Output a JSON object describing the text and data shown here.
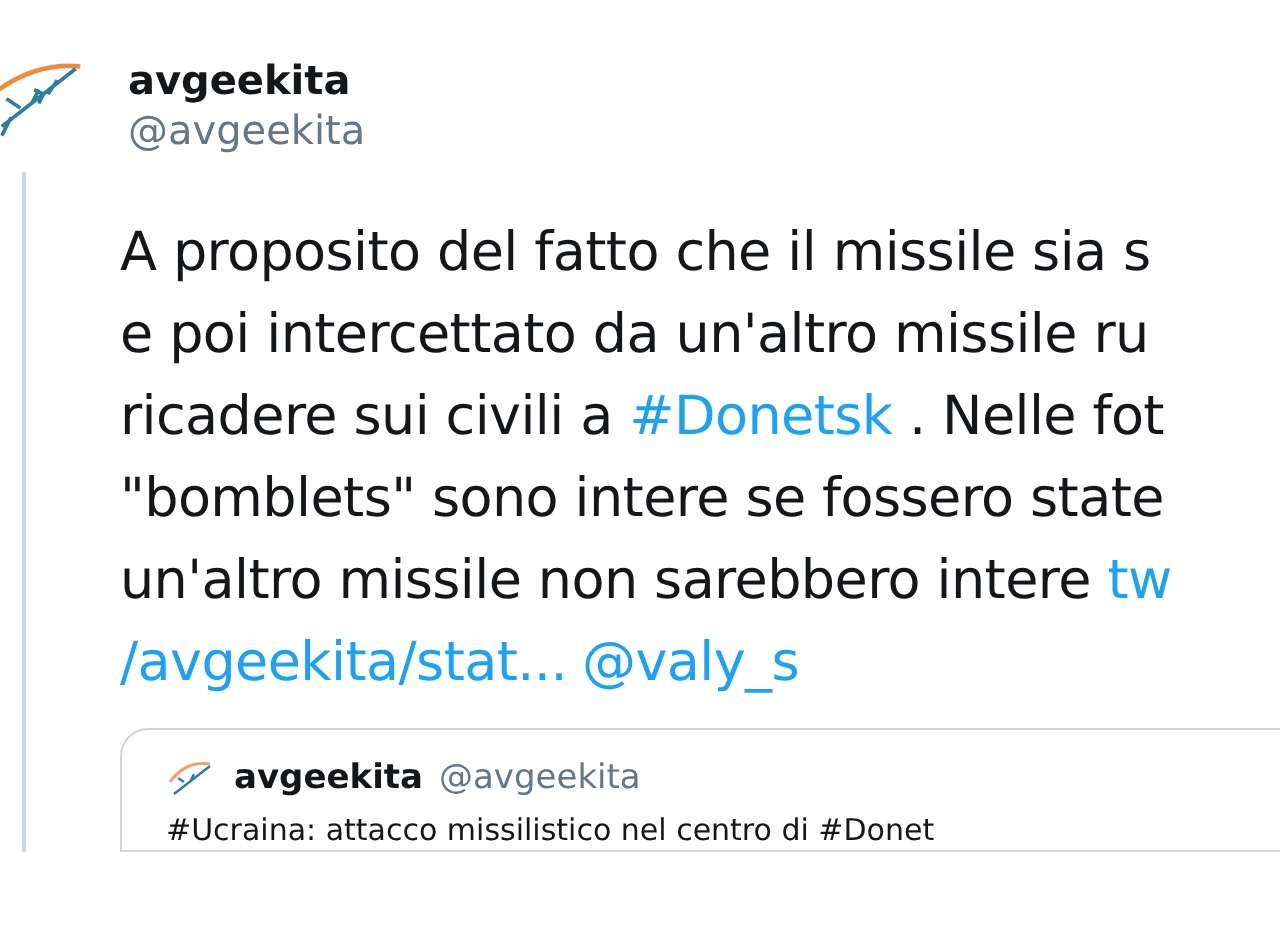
{
  "author": {
    "name": "avgeekita",
    "handle": "@avgeekita"
  },
  "body_lines": [
    [
      {
        "kind": "plain",
        "text": "A proposito del fatto che il missile sia s"
      }
    ],
    [
      {
        "kind": "plain",
        "text": "e poi intercettato da un'altro missile ru"
      }
    ],
    [
      {
        "kind": "plain",
        "text": "ricadere sui civili a "
      },
      {
        "kind": "hashtag",
        "text": "#Donetsk"
      },
      {
        "kind": "plain",
        "text": " . Nelle fot"
      }
    ],
    [
      {
        "kind": "plain",
        "text": "\"bomblets\" sono intere se fossero state"
      }
    ],
    [
      {
        "kind": "plain",
        "text": "un'altro missile non sarebbero intere "
      },
      {
        "kind": "link",
        "text": "tw"
      }
    ],
    [
      {
        "kind": "link",
        "text": "/avgeekita/stat..."
      },
      {
        "kind": "mention",
        "text": "@valy_s"
      }
    ]
  ],
  "quoted_tweet": {
    "name": "avgeekita",
    "handle": "@avgeekita",
    "text": "#Ucraina: attacco missilistico nel centro di #Donet"
  }
}
